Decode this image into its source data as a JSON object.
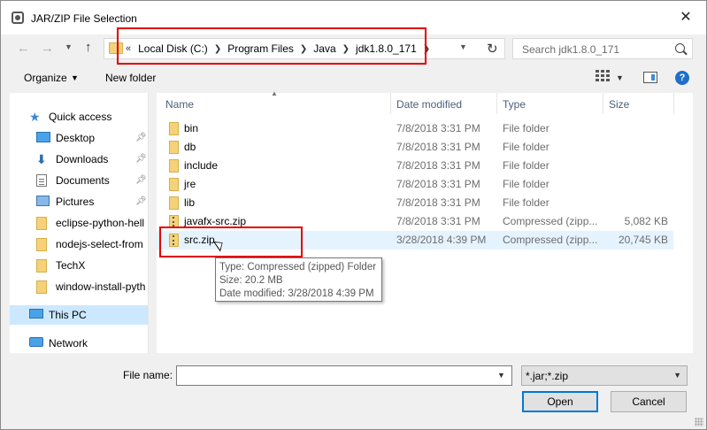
{
  "window": {
    "title": "JAR/ZIP File Selection",
    "close_glyph": "✕"
  },
  "nav": {
    "back_glyph": "←",
    "forward_glyph": "→",
    "up_glyph": "↑",
    "refresh_glyph": "↻"
  },
  "address": {
    "overflow_glyph": "«",
    "crumbs": [
      "Local Disk (C:)",
      "Program Files",
      "Java",
      "jdk1.8.0_171"
    ]
  },
  "search": {
    "placeholder": "Search jdk1.8.0_171"
  },
  "toolbar": {
    "organize_label": "Organize",
    "new_folder_label": "New folder",
    "help_glyph": "?"
  },
  "sidebar": {
    "items": [
      {
        "label": "Quick access",
        "icon": "quick-access-star-icon",
        "root": true
      },
      {
        "label": "Desktop",
        "icon": "desktop-icon",
        "pinned": true
      },
      {
        "label": "Downloads",
        "icon": "downloads-icon",
        "pinned": true
      },
      {
        "label": "Documents",
        "icon": "documents-icon",
        "pinned": true
      },
      {
        "label": "Pictures",
        "icon": "pictures-icon",
        "pinned": true
      },
      {
        "label": "eclipse-python-hell",
        "icon": "folder-icon"
      },
      {
        "label": "nodejs-select-from",
        "icon": "folder-icon"
      },
      {
        "label": "TechX",
        "icon": "folder-icon"
      },
      {
        "label": "window-install-pyth",
        "icon": "folder-icon"
      },
      {
        "label": "This PC",
        "icon": "this-pc-icon",
        "root": true,
        "selected": true
      },
      {
        "label": "Network",
        "icon": "network-icon",
        "root": true
      }
    ]
  },
  "filelist": {
    "columns": {
      "name": "Name",
      "date": "Date modified",
      "type": "Type",
      "size": "Size"
    },
    "rows": [
      {
        "name": "bin",
        "date": "7/8/2018 3:31 PM",
        "type": "File folder",
        "size": "",
        "kind": "folder"
      },
      {
        "name": "db",
        "date": "7/8/2018 3:31 PM",
        "type": "File folder",
        "size": "",
        "kind": "folder"
      },
      {
        "name": "include",
        "date": "7/8/2018 3:31 PM",
        "type": "File folder",
        "size": "",
        "kind": "folder"
      },
      {
        "name": "jre",
        "date": "7/8/2018 3:31 PM",
        "type": "File folder",
        "size": "",
        "kind": "folder"
      },
      {
        "name": "lib",
        "date": "7/8/2018 3:31 PM",
        "type": "File folder",
        "size": "",
        "kind": "folder"
      },
      {
        "name": "javafx-src.zip",
        "date": "7/8/2018 3:31 PM",
        "type": "Compressed (zipp...",
        "size": "5,082 KB",
        "kind": "zip"
      },
      {
        "name": "src.zip",
        "date": "3/28/2018 4:39 PM",
        "type": "Compressed (zipp...",
        "size": "20,745 KB",
        "kind": "zip",
        "hover": true
      }
    ]
  },
  "tooltip": {
    "line1": "Type: Compressed (zipped) Folder",
    "line2": "Size: 20.2 MB",
    "line3": "Date modified: 3/28/2018 4:39 PM"
  },
  "footer": {
    "filename_label": "File name:",
    "filename_value": "",
    "filetype_value": "*.jar;*.zip",
    "open_label": "Open",
    "cancel_label": "Cancel"
  },
  "colors": {
    "highlight_box": "#e00000",
    "selection": "#cce8ff",
    "hover_row": "#e5f3ff",
    "accent": "#0078d7"
  }
}
